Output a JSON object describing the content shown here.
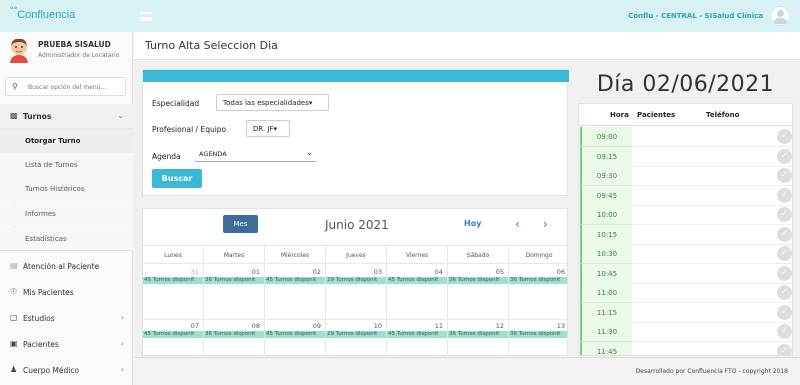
{
  "topbar": {
    "logo_text": "Confluencia",
    "user_info": "Conflu - CENTRAL - SISalud Clínica"
  },
  "sidebar": {
    "user_name": "PRUEBA SISALUD",
    "user_role": "Administrador de Locatario",
    "search_placeholder": "Buscar opción del menú...",
    "turnos_label": "Turnos",
    "submenu": [
      "Otorgar Turno",
      "Lista de Turnos",
      "Turnos Históricos",
      "Informes",
      "Estadísticas"
    ],
    "items": [
      {
        "label": "Atención al Paciente",
        "icon": "lines-icon"
      },
      {
        "label": "Mis Pacientes",
        "icon": "people-icon"
      },
      {
        "label": "Estudios",
        "icon": "file-icon"
      },
      {
        "label": "Pacientes",
        "icon": "id-card-icon"
      },
      {
        "label": "Cuerpo Médico",
        "icon": "doctor-icon"
      }
    ]
  },
  "page": {
    "title": "Turno Alta Seleccion Dia"
  },
  "form": {
    "especialidad_label": "Especialidad",
    "especialidad_value": "Todas las especialidades",
    "profesional_label": "Profesional / Equipo",
    "profesional_value": "DR. JF",
    "agenda_label": "Agenda",
    "agenda_value": "AGENDA",
    "buscar_label": "Buscar"
  },
  "calendar": {
    "mes_label": "Mes",
    "title": "Junio 2021",
    "hoy_label": "Hoy",
    "prev": "‹",
    "next": "›",
    "weekdays": [
      "Lunes",
      "Martes",
      "Miércoles",
      "Jueves",
      "Viernes",
      "Sábado",
      "Domingo"
    ],
    "weeks": [
      [
        {
          "day": "31",
          "event": "45 Turnos disponit",
          "dim": true
        },
        {
          "day": "01",
          "event": "36 Turnos disponit"
        },
        {
          "day": "02",
          "event": "45 Turnos disponit"
        },
        {
          "day": "03",
          "event": "29 Turnos disponit"
        },
        {
          "day": "04",
          "event": "45 Turnos disponit"
        },
        {
          "day": "05",
          "event": "36 Turnos disponit"
        },
        {
          "day": "06",
          "event": "36 Turnos disponit"
        }
      ],
      [
        {
          "day": "07",
          "event": "45 Turnos disponit"
        },
        {
          "day": "08",
          "event": "36 Turnos disponit"
        },
        {
          "day": "09",
          "event": "45 Turnos disponit"
        },
        {
          "day": "10",
          "event": "29 Turnos disponit"
        },
        {
          "day": "11",
          "event": "45 Turnos disponit"
        },
        {
          "day": "12",
          "event": "36 Turnos disponit"
        },
        {
          "day": "13",
          "event": "36 Turnos disponit"
        }
      ]
    ]
  },
  "schedule": {
    "day_title": "Día 02/06/2021",
    "col_hora": "Hora",
    "col_pacientes": "Pacientes",
    "col_telefono": "Teléfono",
    "slots": [
      "09:00",
      "09:15",
      "09:30",
      "09:45",
      "10:00",
      "10:15",
      "10:30",
      "10:45",
      "11:00",
      "11:15",
      "11:30",
      "11:45"
    ]
  },
  "footer": {
    "text": "Desarrollado por Confluencia FTO - copyright 2018"
  }
}
